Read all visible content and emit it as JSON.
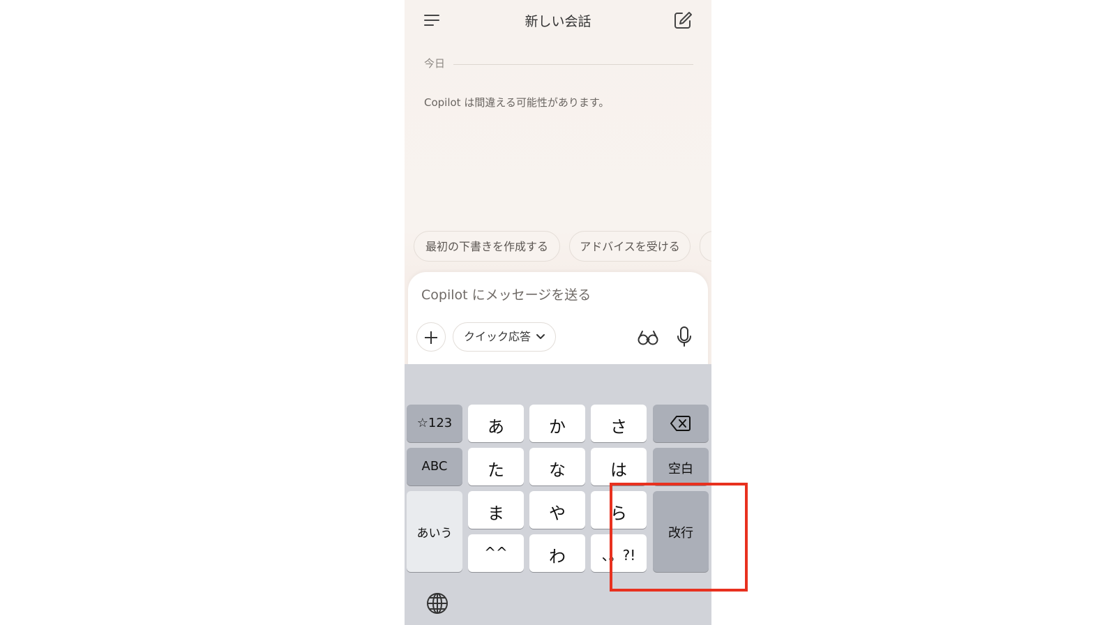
{
  "header": {
    "title": "新しい会話",
    "menu_icon": "hamburger-menu-icon",
    "compose_icon": "compose-edit-icon"
  },
  "chat": {
    "date_divider": "今日",
    "disclaimer": "Copilot は間違える可能性があります。"
  },
  "suggestions": [
    "最初の下書きを作成する",
    "アドバイスを受ける"
  ],
  "composer": {
    "placeholder": "Copilot にメッセージを送る",
    "mode_label": "クイック応答",
    "plus_icon": "plus-icon",
    "glasses_icon": "glasses-icon",
    "mic_icon": "microphone-icon"
  },
  "keyboard": {
    "rows": [
      [
        "☆123",
        "あ",
        "か",
        "さ",
        "⌫"
      ],
      [
        "ABC",
        "た",
        "な",
        "は",
        "空白"
      ],
      [
        "あいう",
        "ま",
        "や",
        "ら",
        "改行"
      ],
      [
        "^^",
        "わ",
        "、。?!"
      ]
    ],
    "keys": {
      "symbols": "☆123",
      "a": "あ",
      "ka": "か",
      "sa": "さ",
      "backspace_icon": "backspace-icon",
      "abc": "ABC",
      "ta": "た",
      "na": "な",
      "ha": "は",
      "space": "空白",
      "aiu": "あいう",
      "ma": "ま",
      "ya": "や",
      "ra": "ら",
      "enter": "改行",
      "kao": "^^",
      "wa": "わ",
      "punct": "、。?!"
    },
    "globe_icon": "globe-icon"
  },
  "annotation": {
    "highlight_color": "#e8311f"
  }
}
